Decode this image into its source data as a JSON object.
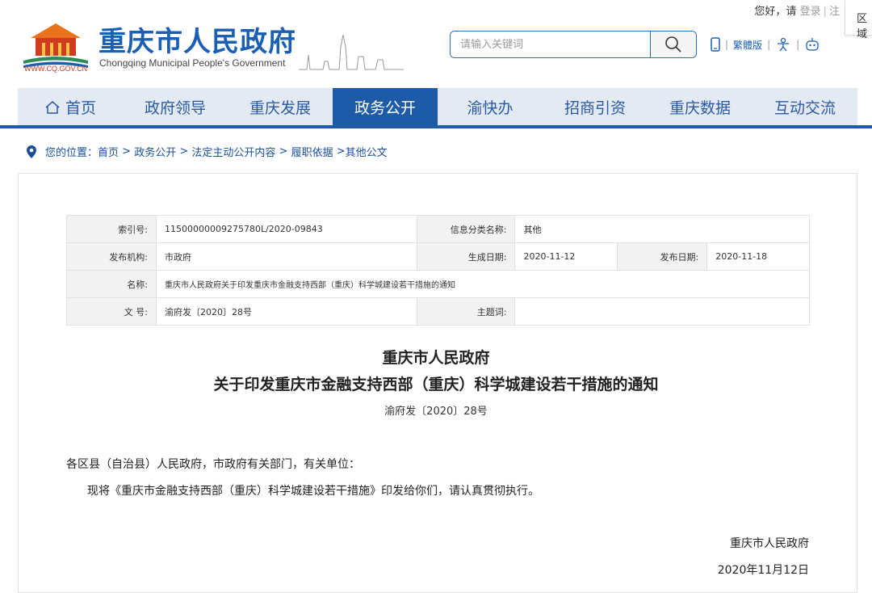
{
  "header": {
    "greeting": "您好，请",
    "login": "登录",
    "register": "注",
    "corner_label": "区域",
    "logo_url": "WWW.CQ.GOV.CN",
    "title": "重庆市人民政府",
    "subtitle": "Chongqing Municipal People's Government",
    "search_placeholder": "请输入关键词",
    "traditional": "繁體版"
  },
  "nav": {
    "items": [
      {
        "label": "首页"
      },
      {
        "label": "政府领导"
      },
      {
        "label": "重庆发展"
      },
      {
        "label": "政务公开"
      },
      {
        "label": "渝快办"
      },
      {
        "label": "招商引资"
      },
      {
        "label": "重庆数据"
      },
      {
        "label": "互动交流"
      }
    ],
    "active_index": 3
  },
  "breadcrumb": {
    "prefix": "您的位置：",
    "items": [
      "首页",
      "政务公开",
      "法定主动公开内容",
      "履职依据",
      "其他公文"
    ]
  },
  "meta": {
    "index_no_label": "索引号:",
    "index_no": "11500000009275780L/2020-09843",
    "category_label": "信息分类名称:",
    "category": "其他",
    "issuer_label": "发布机构:",
    "issuer": "市政府",
    "created_label": "生成日期:",
    "created": "2020-11-12",
    "published_label": "发布日期:",
    "published": "2020-11-18",
    "name_label": "名称:",
    "name": "重庆市人民政府关于印发重庆市金融支持西部（重庆）科学城建设若干措施的通知",
    "doc_no_label": "文 号:",
    "doc_no": "渝府发〔2020〕28号",
    "subject_label": "主题词:",
    "subject": ""
  },
  "document": {
    "title1": "重庆市人民政府",
    "title2": "关于印发重庆市金融支持西部（重庆）科学城建设若干措施的通知",
    "number": "渝府发〔2020〕28号",
    "salutation": "各区县（自治县）人民政府，市政府有关部门，有关单位：",
    "body": "现将《重庆市金融支持西部（重庆）科学城建设若干措施》印发给你们，请认真贯彻执行。",
    "signature": "重庆市人民政府",
    "date": "2020年11月12日"
  },
  "colors": {
    "brand_blue": "#1d5aa8",
    "nav_bg": "#e4eaf3",
    "logo_red": "#d13b1f"
  }
}
